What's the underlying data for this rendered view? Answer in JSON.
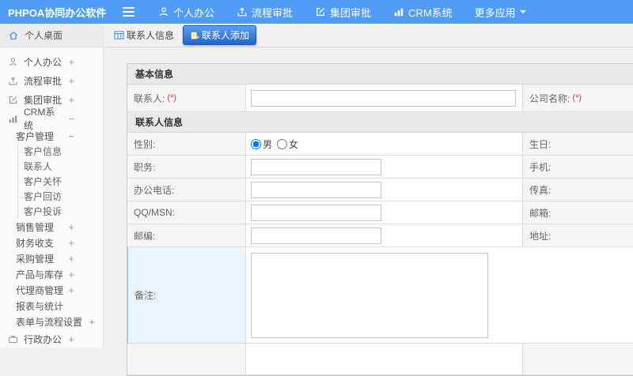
{
  "colors": {
    "header_bg": "#519cf6",
    "active_tab_top": "#5aa0f2",
    "active_tab_bottom": "#2365c7",
    "required_red": "#e23b3b",
    "remark_highlight_bg": "#e9f4fc"
  },
  "header": {
    "logo": "PHPOA协同办公软件",
    "nav": [
      {
        "label": "个人办公",
        "icon": "user-icon"
      },
      {
        "label": "流程审批",
        "icon": "flow-approve-icon"
      },
      {
        "label": "集团审批",
        "icon": "edit-approve-icon"
      },
      {
        "label": "CRM系统",
        "icon": "bar-chart-icon"
      },
      {
        "label": "更多应用",
        "icon": "caret-down-icon"
      }
    ]
  },
  "tabs": [
    {
      "label": "联系人信息",
      "active": false
    },
    {
      "label": "联系人添加",
      "active": true
    }
  ],
  "sidebar": {
    "items": [
      {
        "label": "个人桌面",
        "expand": "",
        "icon": "home-icon",
        "active": true
      },
      {
        "label": "个人办公",
        "expand": "+",
        "icon": "user-icon"
      },
      {
        "label": "流程审批",
        "expand": "+",
        "icon": "flow-approve-icon"
      },
      {
        "label": "集团审批",
        "expand": "+",
        "icon": "edit-approve-icon"
      },
      {
        "label": "CRM系统",
        "expand": "−",
        "icon": "bar-chart-icon"
      },
      {
        "label": "客户管理",
        "expand": "−"
      },
      {
        "label": "客户信息",
        "expand": ""
      },
      {
        "label": "联系人",
        "expand": ""
      },
      {
        "label": "客户关怀",
        "expand": ""
      },
      {
        "label": "客户回访",
        "expand": ""
      },
      {
        "label": "客户投诉",
        "expand": ""
      },
      {
        "label": "销售管理",
        "expand": "+"
      },
      {
        "label": "财务收支",
        "expand": "+"
      },
      {
        "label": "采购管理",
        "expand": "+"
      },
      {
        "label": "产品与库存",
        "expand": "+"
      },
      {
        "label": "代理商管理",
        "expand": "+"
      },
      {
        "label": "报表与统计",
        "expand": ""
      },
      {
        "label": "表单与流程设置",
        "expand": "+"
      },
      {
        "label": "行政办公",
        "expand": "+",
        "icon": "briefcase-icon"
      }
    ]
  },
  "form": {
    "sections": {
      "basic": "基本信息",
      "contact": "联系人信息"
    },
    "required_mark": "(*)",
    "fields": {
      "contact_name": "联系人:",
      "company_name": "公司名称:",
      "gender": "性别:",
      "birthday": "生日:",
      "job_title": "职务:",
      "mobile": "手机:",
      "office_phone": "办公电话:",
      "fax": "传真:",
      "qq_msn": "QQ/MSN:",
      "email": "邮箱:",
      "zip": "邮编:",
      "address": "地址:",
      "remark": "备注:"
    },
    "gender_options": {
      "male": "男",
      "female": "女"
    }
  }
}
